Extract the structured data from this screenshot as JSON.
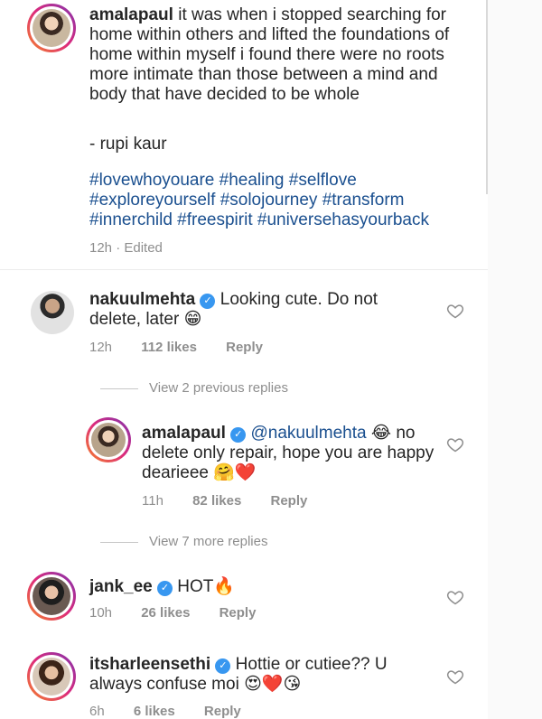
{
  "caption": {
    "username": "amalapaul",
    "text": "it was when i stopped searching for home within others and lifted the foundations of home within myself i found there were no roots more intimate than those between a mind and body that have decided to be whole",
    "attribution": "- rupi kaur",
    "hashtags": "#lovewhoyouare #healing #selflove #exploreyourself #solojourney #transform #innerchild #freespirit #universehasyourback",
    "meta": "12h · Edited"
  },
  "comments": [
    {
      "username": "nakuulmehta",
      "verified": true,
      "text": "Looking cute. Do not delete, later 😁",
      "time": "12h",
      "likes": "112 likes",
      "reply_label": "Reply"
    },
    {
      "username": "jank_ee",
      "verified": true,
      "text": "HOT🔥",
      "time": "10h",
      "likes": "26 likes",
      "reply_label": "Reply"
    },
    {
      "username": "itsharleensethi",
      "verified": true,
      "text": "Hottie or cutiee?? U always confuse moi 😍❤️😘",
      "time": "6h",
      "likes": "6 likes",
      "reply_label": "Reply"
    }
  ],
  "view_previous_replies": "View 2 previous replies",
  "reply": {
    "username": "amalapaul",
    "verified": true,
    "mention": "@nakuulmehta",
    "text": "😂 no delete only repair, hope you are happy dearieee 🤗❤️",
    "time": "11h",
    "likes": "82 likes",
    "reply_label": "Reply"
  },
  "view_more_replies": "View 7 more replies",
  "colors": {
    "link": "#1a4f8f",
    "verified": "#3897f0",
    "muted": "#8e8e8e"
  }
}
